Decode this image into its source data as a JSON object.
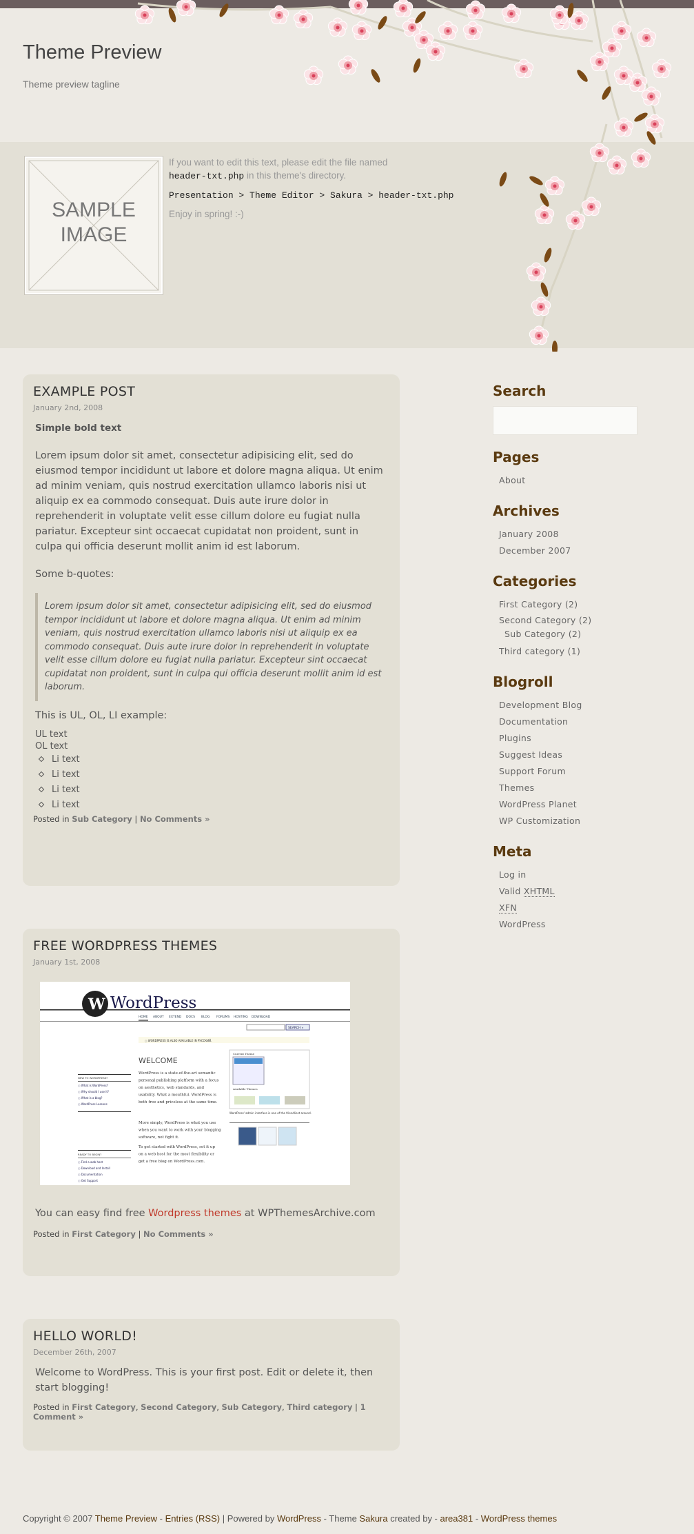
{
  "colors": {
    "topbar": "#6b5e5e",
    "background": "#edeae4",
    "band": "#e3e0d6",
    "card": "#e3e0d5",
    "heading": "#5a3a10",
    "link_red": "#c0392b",
    "blossom": "#f3a7b1"
  },
  "header": {
    "title": "Theme Preview",
    "tagline": "Theme preview tagline"
  },
  "intro": {
    "sample_line1": "SAMPLE",
    "sample_line2": "IMAGE",
    "line1": "If you want to edit this text, please edit the file named",
    "file": "header-txt.php",
    "line2": " in this theme's directory.",
    "path": "Presentation > Theme Editor > Sakura > header-txt.php",
    "enjoy": "Enjoy in spring! :-)"
  },
  "posts": [
    {
      "title": "EXAMPLE POST",
      "date": "January 2nd, 2008",
      "bold": "Simple bold text",
      "para": "Lorem ipsum dolor sit amet, consectetur adipisicing elit, sed do eiusmod tempor incididunt ut labore et dolore magna aliqua. Ut enim ad minim veniam, quis nostrud exercitation ullamco laboris nisi ut aliquip ex ea commodo consequat. Duis aute irure dolor in reprehenderit in voluptate velit esse cillum dolore eu fugiat nulla pariatur. Excepteur sint occaecat cupidatat non proident, sunt in culpa qui officia deserunt mollit anim id est laborum.",
      "bq_label": "Some b-quotes:",
      "quote": "Lorem ipsum dolor sit amet, consectetur adipisicing elit, sed do eiusmod tempor incididunt ut labore et dolore magna aliqua. Ut enim ad minim veniam, quis nostrud exercitation ullamco laboris nisi ut aliquip ex ea commodo consequat. Duis aute irure dolor in reprehenderit in voluptate velit esse cillum dolore eu fugiat nulla pariatur. Excepteur sint occaecat cupidatat non proident, sunt in culpa qui officia deserunt mollit anim id est laborum.",
      "list_label": "This is UL, OL, LI example:",
      "ul": "UL text",
      "ol": "OL text",
      "li": [
        "Li text",
        "Li text",
        "Li text",
        "Li text"
      ],
      "posted_in": "Posted in ",
      "cats": [
        "Sub Category"
      ],
      "sep": " | ",
      "comments": "No Comments »"
    },
    {
      "title": "FREE WORDPRESS THEMES",
      "date": "January 1st, 2008",
      "screenshot": {
        "logo": "WordPress",
        "nav": [
          "HOME",
          "ABOUT",
          "EXTEND",
          "DOCS",
          "BLOG",
          "FORUMS",
          "HOSTING",
          "DOWNLOAD"
        ],
        "search": "SEARCH »",
        "notice": "WORDPRESS IS ALSO AVAILABLE IN РУССКИЙ.",
        "welcome": "WELCOME",
        "new_title": "NEW TO WORDPRESS?",
        "new_items": [
          "What is WordPress?",
          "Why should I use it?",
          "What is a blog?",
          "WordPress Lessons"
        ],
        "ready_title": "READY TO BEGIN?",
        "ready_items": [
          "Find a web host",
          "Download and Install",
          "Documentation",
          "Get Support"
        ],
        "intro": "WordPress is a state-of-the-art semantic personal publishing platform with a focus on aesthetics, web standards, and usability. What a mouthful. WordPress is both free and priceless at the same time.",
        "more": "More simply, WordPress is what you use when you want to work with your blogging software, not fight it.",
        "start": "To get started with WordPress, set it up on a web host for the most flexibility or get a free blog on WordPress.com.",
        "current": "Current Theme",
        "available": "Available Themes",
        "caption": "WordPress' admin interface is one of the friendliest around."
      },
      "text_pre": "You can easy find free ",
      "text_link": "Wordpress themes",
      "text_post": " at WPThemesArchive.com",
      "posted_in": "Posted in ",
      "cats": [
        "First Category"
      ],
      "sep": " | ",
      "comments": "No Comments »"
    },
    {
      "title": "HELLO WORLD!",
      "date": "December 26th, 2007",
      "para": "Welcome to WordPress. This is your first post. Edit or delete it, then start blogging!",
      "posted_in": "Posted in ",
      "cats": [
        "First Category",
        "Second Category",
        "Sub Category",
        "Third category"
      ],
      "sep": " | ",
      "comments": "1 Comment »"
    }
  ],
  "sidebar": {
    "search": "Search",
    "search_value": "",
    "pages": {
      "title": "Pages",
      "items": [
        "About"
      ]
    },
    "archives": {
      "title": "Archives",
      "items": [
        "January 2008",
        "December 2007"
      ]
    },
    "categories": {
      "title": "Categories",
      "items": [
        "First Category (2)",
        "Second Category (2)",
        "Sub Category (2)",
        "Third category (1)"
      ]
    },
    "blogroll": {
      "title": "Blogroll",
      "items": [
        "Development Blog",
        "Documentation",
        "Plugins",
        "Suggest Ideas",
        "Support Forum",
        "Themes",
        "WordPress Planet",
        "WP Customization"
      ]
    },
    "meta": {
      "title": "Meta",
      "login": "Log in",
      "valid": "Valid ",
      "xhtml": "XHTML",
      "xfn": "XFN",
      "wp": "WordPress"
    }
  },
  "footer": {
    "copy": "Copyright © 2007 ",
    "site": "Theme Preview",
    "dash1": " - ",
    "entries": "Entries (RSS)",
    "mid": " | Powered by ",
    "wp": "WordPress",
    "mid2": " - Theme ",
    "sakura": "Sakura",
    "created": " created by - ",
    "area": "area381",
    "dash2": " - ",
    "themes": "WordPress themes"
  }
}
